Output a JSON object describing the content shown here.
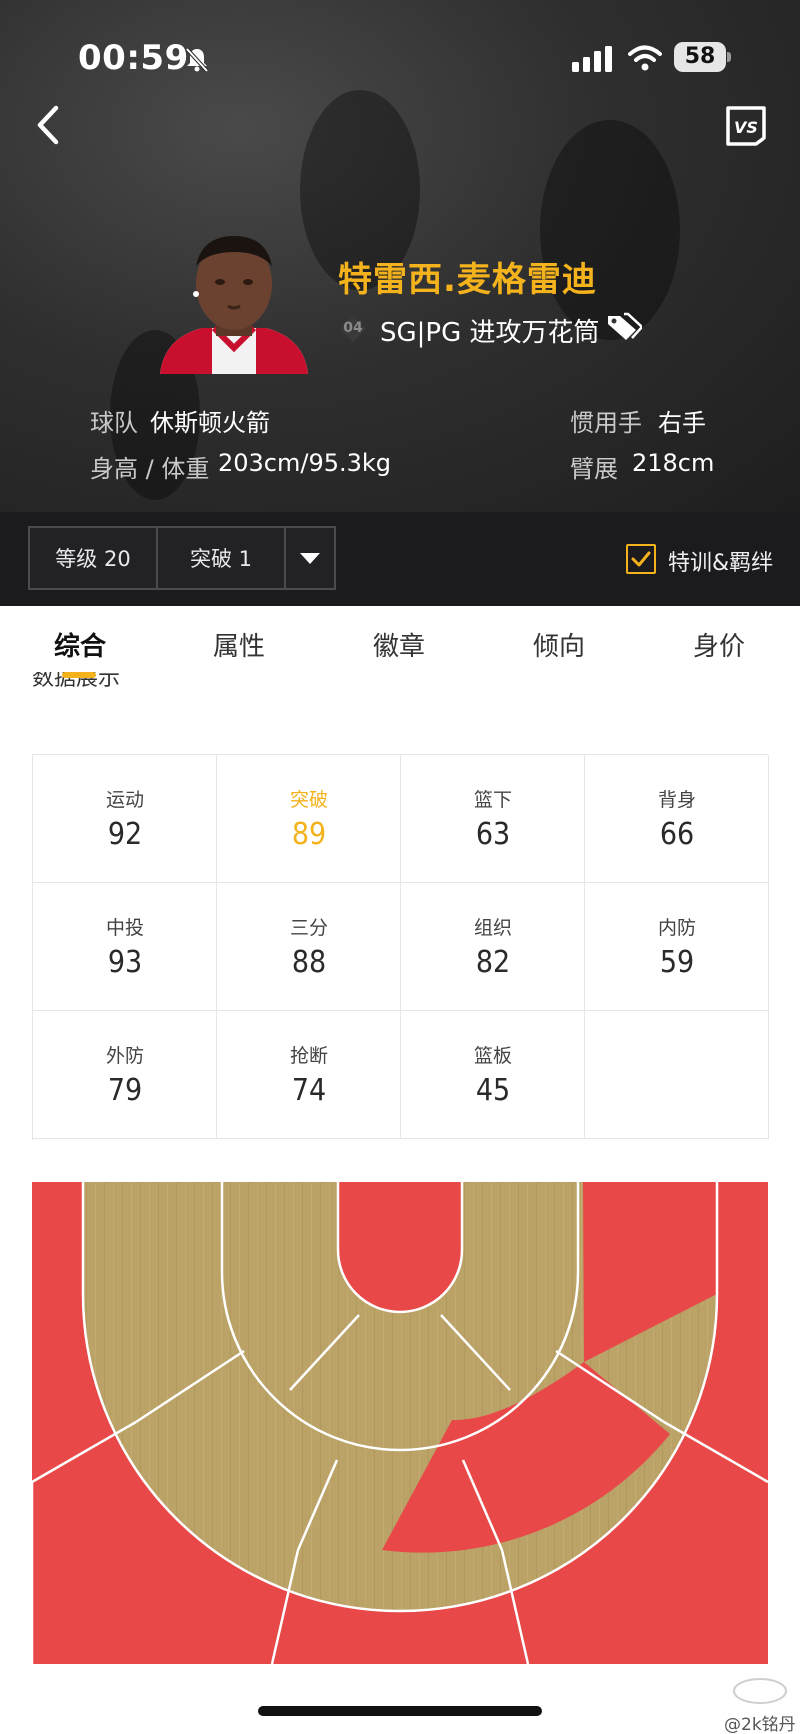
{
  "status_bar": {
    "time": "00:59",
    "battery": "58"
  },
  "header": {
    "player_name": "特雷西.麦格雷迪",
    "jersey_number": "04",
    "role": "SG|PG 进攻万花筒",
    "team_label": "球队",
    "team_value": "休斯顿火箭",
    "hand_label": "惯用手",
    "hand_value": "右手",
    "height_weight_label": "身高 / 体重",
    "height_weight_value": "203cm/95.3kg",
    "wingspan_label": "臂展",
    "wingspan_value": "218cm",
    "icons": [
      "back-arrow-icon",
      "vs-icon",
      "tag-icon"
    ]
  },
  "toolbar": {
    "level": "等级 20",
    "breakthrough": "突破 1",
    "training_label": "特训&羁绊",
    "training_checked": true
  },
  "tabs": [
    "综合",
    "属性",
    "徽章",
    "倾向",
    "身价"
  ],
  "active_tab": "综合",
  "section_heading": "数据展示",
  "stats": [
    {
      "label": "运动",
      "value": "92"
    },
    {
      "label": "突破",
      "value": "89",
      "highlight": true
    },
    {
      "label": "篮下",
      "value": "63"
    },
    {
      "label": "背身",
      "value": "66"
    },
    {
      "label": "中投",
      "value": "93"
    },
    {
      "label": "三分",
      "value": "88"
    },
    {
      "label": "组织",
      "value": "82"
    },
    {
      "label": "内防",
      "value": "59"
    },
    {
      "label": "外防",
      "value": "79"
    },
    {
      "label": "抢断",
      "value": "74"
    },
    {
      "label": "篮板",
      "value": "45"
    }
  ],
  "court": {
    "zone_colors": {
      "hot": "#e84848",
      "neutral": "#b9a062"
    }
  },
  "watermark": "@2k铭丹",
  "colors": {
    "accent": "#f4b21c",
    "dark": "#1b1b1f"
  }
}
